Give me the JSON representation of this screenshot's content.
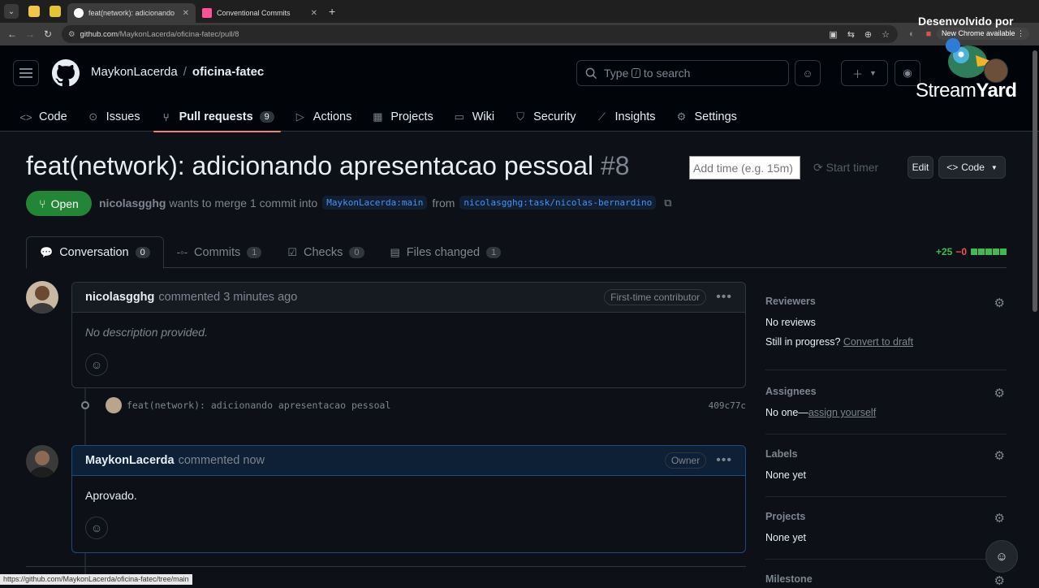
{
  "browser": {
    "tabs": [
      {
        "label": "feat(network): adicionando",
        "active": true
      },
      {
        "label": "Conventional Commits",
        "active": false
      }
    ],
    "url_host": "github.com",
    "url_path": "/MaykonLacerda/oficina-fatec/pull/8",
    "update_notice": "New Chrome available",
    "status_url": "https://github.com/MaykonLacerda/oficina-fatec/tree/main"
  },
  "overlay": {
    "label": "Desenvolvido por",
    "brand_a": "Stream",
    "brand_b": "Yard"
  },
  "header": {
    "owner": "MaykonLacerda",
    "separator": "/",
    "repo": "oficina-fatec",
    "search_prefix": "Type",
    "search_key": "/",
    "search_suffix": "to search"
  },
  "repo_nav": [
    {
      "label": "Code",
      "icon": "code-icon"
    },
    {
      "label": "Issues",
      "icon": "issue-icon"
    },
    {
      "label": "Pull requests",
      "icon": "pull-request-icon",
      "count": "9",
      "selected": true
    },
    {
      "label": "Actions",
      "icon": "play-icon"
    },
    {
      "label": "Projects",
      "icon": "table-icon"
    },
    {
      "label": "Wiki",
      "icon": "book-icon"
    },
    {
      "label": "Security",
      "icon": "shield-icon"
    },
    {
      "label": "Insights",
      "icon": "graph-icon"
    },
    {
      "label": "Settings",
      "icon": "gear-icon"
    }
  ],
  "pr": {
    "title": "feat(network): adicionando apresentacao pessoal",
    "number": "#8",
    "time_placeholder": "Add time (e.g. 15m)",
    "start_timer": "Start timer",
    "edit": "Edit",
    "code": "Code",
    "state": "Open",
    "author": "nicolasgghg",
    "merge_text": "wants to merge 1 commit into",
    "base_branch": "MaykonLacerda:main",
    "from_text": "from",
    "head_branch": "nicolasgghg:task/nicolas-bernardino"
  },
  "pr_tabs": [
    {
      "label": "Conversation",
      "count": "0",
      "icon": "comment-icon",
      "selected": true
    },
    {
      "label": "Commits",
      "count": "1",
      "icon": "commit-icon"
    },
    {
      "label": "Checks",
      "count": "0",
      "icon": "checklist-icon"
    },
    {
      "label": "Files changed",
      "count": "1",
      "icon": "file-diff-icon"
    }
  ],
  "diffstat": {
    "additions": "+25",
    "deletions": "−0"
  },
  "timeline": {
    "comment1": {
      "author": "nicolasgghg",
      "meta": "commented 3 minutes ago",
      "badge": "First-time contributor",
      "body": "No description provided."
    },
    "commit": {
      "message": "feat(network): adicionando apresentacao pessoal",
      "sha": "409c77c"
    },
    "comment2": {
      "author": "MaykonLacerda",
      "meta": "commented now",
      "badge": "Owner",
      "body": "Aprovado."
    }
  },
  "sidebar": {
    "reviewers": {
      "title": "Reviewers",
      "value": "No reviews",
      "progress_label": "Still in progress?",
      "progress_link": "Convert to draft"
    },
    "assignees": {
      "title": "Assignees",
      "value": "No one—",
      "link": "assign yourself"
    },
    "labels": {
      "title": "Labels",
      "value": "None yet"
    },
    "projects": {
      "title": "Projects",
      "value": "None yet"
    },
    "milestone": {
      "title": "Milestone"
    }
  },
  "colors": {
    "accent_open": "#238636",
    "link_blue": "#4493f8",
    "tab_underline": "#f78166"
  }
}
